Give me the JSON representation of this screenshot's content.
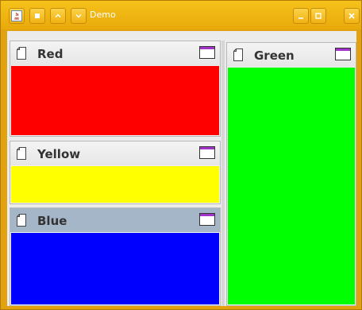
{
  "window": {
    "title": "Demo",
    "frame_color": "#e8a90b"
  },
  "titlebar": {
    "icons": [
      "java-app-icon",
      "menu-icon",
      "chevron-up-icon",
      "chevron-down-icon"
    ],
    "controls": [
      "minimize-icon",
      "maximize-icon",
      "close-icon"
    ]
  },
  "panels": [
    {
      "title": "Red",
      "color": "#ff0000",
      "active": false
    },
    {
      "title": "Yellow",
      "color": "#ffff00",
      "active": false
    },
    {
      "title": "Blue",
      "color": "#0000ff",
      "active": true
    },
    {
      "title": "Green",
      "color": "#00ff00",
      "active": false
    }
  ]
}
